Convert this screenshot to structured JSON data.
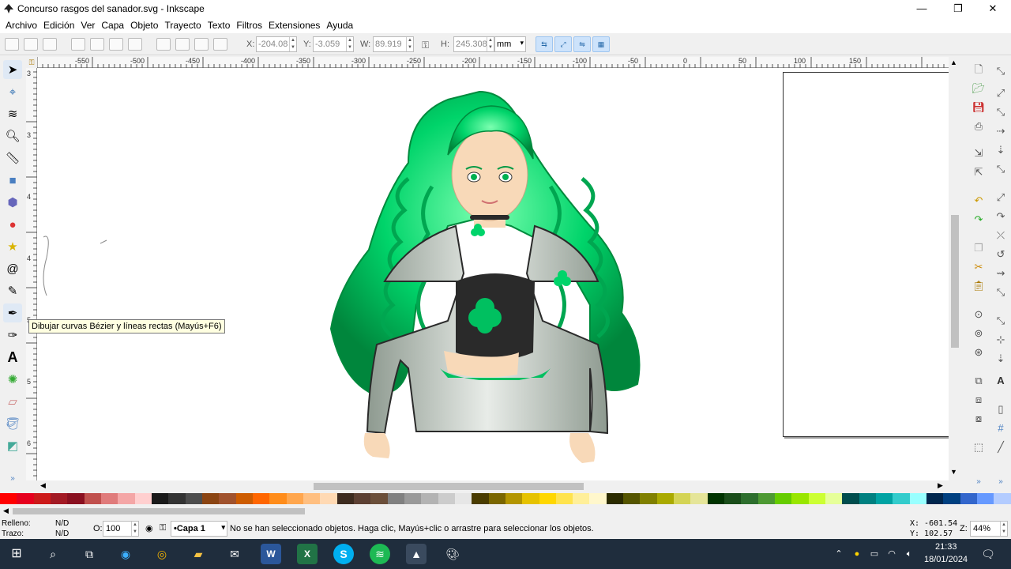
{
  "window": {
    "title": "Concurso rasgos del sanador.svg - Inkscape",
    "minimize": "—",
    "maximize": "❐",
    "close": "✕"
  },
  "menu": [
    "Archivo",
    "Edición",
    "Ver",
    "Capa",
    "Objeto",
    "Trayecto",
    "Texto",
    "Filtros",
    "Extensiones",
    "Ayuda"
  ],
  "controls": {
    "x_label": "X:",
    "x_value": "-204.08",
    "y_label": "Y:",
    "y_value": "-3.059",
    "w_label": "W:",
    "w_value": "89.919",
    "h_label": "H:",
    "h_value": "245.308",
    "unit": "mm"
  },
  "ruler": {
    "top": [
      "-550",
      "-500",
      "-450",
      "-400",
      "-350",
      "-300",
      "-250",
      "-200",
      "-150",
      "-100",
      "-50",
      "0",
      "50",
      "100",
      "150"
    ],
    "left": [
      "3",
      "3",
      "4",
      "4",
      "5",
      "5",
      "6"
    ]
  },
  "tooltip": "Dibujar curvas Bézier y líneas rectas (Mayús+F6)",
  "status": {
    "fill_label": "Relleno:",
    "fill_value": "N/D",
    "stroke_label": "Trazo:",
    "stroke_value": "N/D",
    "opacity_label": "O:",
    "opacity_value": "100",
    "layer": "•Capa 1",
    "message": "No se han seleccionado objetos. Haga clic, Mayús+clic o arrastre para seleccionar los objetos.",
    "x_coord": "X: -601.54",
    "y_coord": "Y: 102.57",
    "zoom_label": "Z:",
    "zoom_value": "44%"
  },
  "taskbar": {
    "time": "21:33",
    "date": "18/01/2024"
  },
  "colors": {
    "accent": "#00d46a",
    "hair_dark": "#009944",
    "jacket": "#c8c8c8",
    "skin": "#f8d9b8",
    "taskbar": "#1f2d3d"
  },
  "palette": [
    "#ff0000",
    "#e6001e",
    "#cc1a1a",
    "#a31a24",
    "#8a1020",
    "#c0504d",
    "#e07b7b",
    "#f4a6a6",
    "#ffcfcf",
    "#1a1a1a",
    "#333333",
    "#4d4d4d",
    "#8b4513",
    "#a0522d",
    "#cd5c00",
    "#ff6600",
    "#ff8c1a",
    "#ffa64d",
    "#ffbf80",
    "#ffd9b3",
    "#3d2b1f",
    "#5c4033",
    "#6b4f3a",
    "#808080",
    "#999999",
    "#b3b3b3",
    "#cccccc",
    "#e6e6e6",
    "#4a3c00",
    "#7a6600",
    "#b39500",
    "#e6c200",
    "#ffd700",
    "#ffe34d",
    "#ffef99",
    "#fff7cc",
    "#2b2b00",
    "#555500",
    "#808000",
    "#aaaa00",
    "#d4d455",
    "#e5e599",
    "#003300",
    "#1a4d1a",
    "#2d6e2d",
    "#4d9933",
    "#66cc00",
    "#99e600",
    "#ccff33",
    "#e6ff99",
    "#004d4d",
    "#008080",
    "#00a3a3",
    "#33cccc",
    "#99ffff",
    "#00264d",
    "#004080",
    "#3366cc",
    "#6699ff",
    "#b3ccff"
  ],
  "left_tools": [
    "selector-tool",
    "node-tool",
    "tweak-tool",
    "zoom-tool",
    "measure-tool",
    "rect-tool",
    "3dbox-tool",
    "ellipse-tool",
    "star-tool",
    "spiral-tool",
    "pencil-tool",
    "bezier-tool",
    "calligraphy-tool",
    "text-tool",
    "spray-tool",
    "eraser-tool",
    "bucket-tool",
    "gradient-tool"
  ]
}
